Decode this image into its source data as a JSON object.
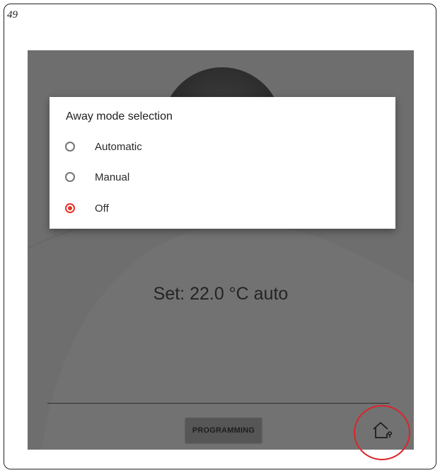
{
  "page": {
    "number": "49"
  },
  "thermostat": {
    "set_text": "Set: 22.0 °C auto",
    "programming_label": "PROGRAMMING",
    "home_icon": "home-location-icon"
  },
  "dialog": {
    "title": "Away mode selection",
    "options": [
      {
        "label": "Automatic",
        "checked": false
      },
      {
        "label": "Manual",
        "checked": false
      },
      {
        "label": "Off",
        "checked": true
      }
    ]
  },
  "colors": {
    "accent": "#e53325",
    "annotation": "#d8262b",
    "overlay_background": "#6e6e6e"
  }
}
